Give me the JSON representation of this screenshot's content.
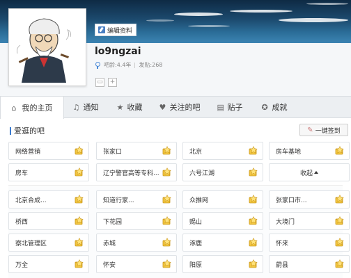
{
  "profile": {
    "edit_label": "编辑资料",
    "username": "lo9ngzai",
    "age_label": "吧龄:4.4年",
    "posts_label": "发贴:268"
  },
  "nav": {
    "items": [
      {
        "label": "我的主页",
        "icon": "home-icon"
      },
      {
        "label": "通知",
        "icon": "bell-icon"
      },
      {
        "label": "收藏",
        "icon": "star-icon"
      },
      {
        "label": "关注的吧",
        "icon": "heart-icon"
      },
      {
        "label": "贴子",
        "icon": "document-icon"
      },
      {
        "label": "成就",
        "icon": "badge-icon"
      }
    ]
  },
  "section": {
    "title": "爱逛的吧",
    "sign_all": "一键签到",
    "collapse": "收起"
  },
  "bars_top": [
    [
      "网络营销",
      "张家口",
      "北京",
      "房车基地"
    ],
    [
      "房车",
      "辽宁警官高等专科...",
      "六号江湖"
    ]
  ],
  "bars_more": [
    [
      "北京合成...",
      "知道行家...",
      "众推网",
      "张家口市..."
    ],
    [
      "桥西",
      "下花园",
      "赐山",
      "大境门"
    ],
    [
      "察北管理区",
      "赤城",
      "涿鹿",
      "怀来"
    ],
    [
      "万全",
      "怀安",
      "阳原",
      "蔚县"
    ]
  ],
  "colors": {
    "accent": "#3b7bd0",
    "sign_star": "#f0b71a",
    "banner": "#1c4a6e"
  }
}
